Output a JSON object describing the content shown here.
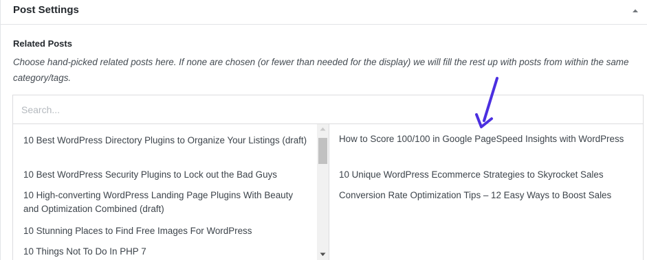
{
  "metabox": {
    "title": "Post Settings",
    "collapse_icon": "triangle-up-icon"
  },
  "related_posts": {
    "heading": "Related Posts",
    "description": "Choose hand-picked related posts here. If none are chosen (or fewer than needed for the display) we will fill the rest up with posts from within the same category/tags.",
    "search": {
      "value": "",
      "placeholder": "Search..."
    },
    "available_posts": [
      {
        "title": "10 Best WordPress Directory Plugins to Organize Your Listings (draft)"
      },
      {
        "title": "10 Best WordPress Security Plugins to Lock out the Bad Guys"
      },
      {
        "title": "10 High-converting WordPress Landing Page Plugins With Beauty and Optimization Combined (draft)"
      },
      {
        "title": "10 Stunning Places to Find Free Images For WordPress"
      },
      {
        "title": "10 Things Not To Do In PHP 7"
      }
    ],
    "selected_posts": [
      {
        "title": "How to Score 100/100 in Google PageSpeed Insights with WordPress"
      },
      {
        "title": "10 Unique WordPress Ecommerce Strategies to Skyrocket Sales"
      },
      {
        "title": "Conversion Rate Optimization Tips – 12 Easy Ways to Boost Sales"
      }
    ]
  },
  "annotation": {
    "icon": "annotation-arrow-icon",
    "color": "#4b2fe0"
  },
  "colors": {
    "border": "#dcdcde",
    "text": "#3c434a",
    "heading": "#23282d",
    "placeholder": "#b4b9be"
  }
}
